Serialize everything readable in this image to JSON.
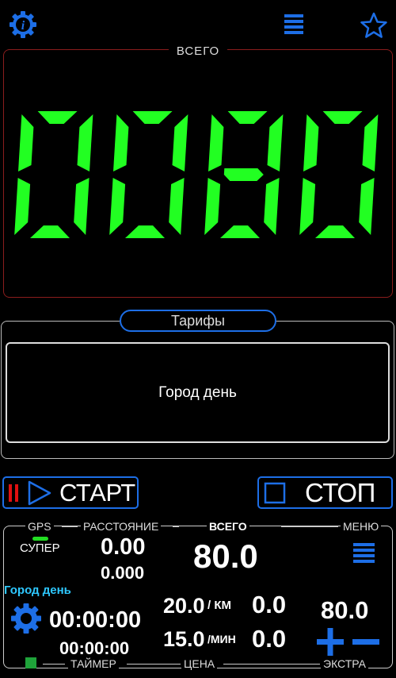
{
  "colors": {
    "accent": "#1d6ee6",
    "digits": "#22ff22",
    "start_red": "#e01010",
    "gps_green": "#22dd22",
    "tariff_label": "#2ec8ff",
    "timer_square": "#1fa33a"
  },
  "top_bar": {
    "info_icon": "info-gear-icon",
    "menu_icon": "hamburger-icon",
    "favorite_icon": "star-icon"
  },
  "total": {
    "label": "ВСЕГО",
    "display": "0080"
  },
  "tariffs": {
    "title": "Тарифы",
    "current": "Город день"
  },
  "controls": {
    "start_label": "СТАРТ",
    "stop_label": "СТОП"
  },
  "bottom": {
    "gps_label": "GPS",
    "distance_header": "РАССТОЯНИЕ",
    "total_header": "ВСЕГО",
    "menu_header": "МЕНЮ",
    "mode_label": "СУПЕР",
    "distance_value": "0.00",
    "distance_sub": "0.000",
    "total_value": "80.0",
    "tariff_name": "Город день",
    "timer_main": "00:00:00",
    "timer_sub": "00:00:00",
    "price_per_km": "20.0",
    "per_km_unit": "/ КМ",
    "price_per_min": "15.0",
    "per_min_unit": "/МИН",
    "km_amount": "0.0",
    "min_amount": "0.0",
    "extra_value": "80.0",
    "timer_footer": "ТАЙМЕР",
    "price_footer": "ЦЕНА",
    "extra_footer": "ЭКСТРА"
  }
}
